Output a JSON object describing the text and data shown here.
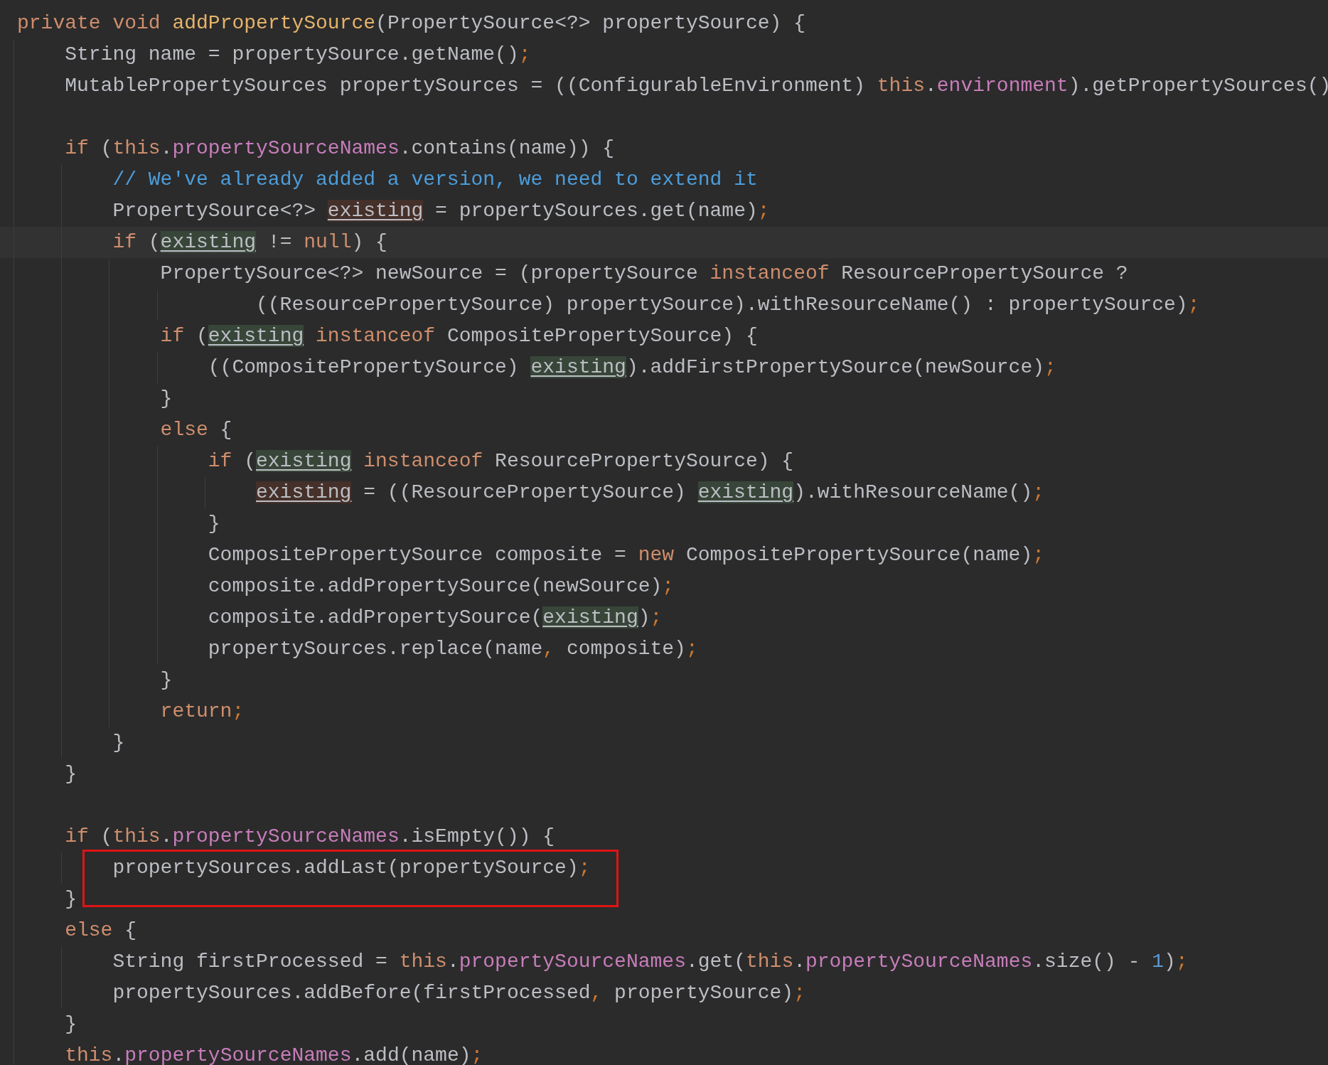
{
  "editor": {
    "lines": [
      {
        "tokens": [
          {
            "kind": "keyword",
            "text": "private void "
          },
          {
            "kind": "method",
            "text": "addPropertySource"
          },
          {
            "kind": "plain",
            "text": "(PropertySource<?> propertySource) {"
          }
        ],
        "children": [
          {
            "tokens": [
              {
                "kind": "plain",
                "text": "String name = propertySource.getName()"
              },
              {
                "kind": "punct",
                "text": ";"
              }
            ]
          },
          {
            "tokens": [
              {
                "kind": "plain",
                "text": "MutablePropertySources propertySources = ((ConfigurableEnvironment) "
              },
              {
                "kind": "keyword",
                "text": "this"
              },
              {
                "kind": "plain",
                "text": "."
              },
              {
                "kind": "field",
                "text": "environment"
              },
              {
                "kind": "plain",
                "text": ").getPropertySources()"
              }
            ]
          },
          {
            "space_before": true,
            "tokens": [
              {
                "kind": "keyword",
                "text": "if"
              },
              {
                "kind": "plain",
                "text": " ("
              },
              {
                "kind": "keyword",
                "text": "this"
              },
              {
                "kind": "plain",
                "text": "."
              },
              {
                "kind": "field",
                "text": "propertySourceNames"
              },
              {
                "kind": "plain",
                "text": ".contains(name)) {"
              }
            ],
            "children": [
              {
                "tokens": [
                  {
                    "kind": "comment",
                    "text": "// We've already added a version, we need to extend it"
                  }
                ]
              },
              {
                "tokens": [
                  {
                    "kind": "plain",
                    "text": "PropertySource<?> "
                  },
                  {
                    "kind": "write",
                    "text": "existing"
                  },
                  {
                    "kind": "plain",
                    "text": " = propertySources.get(name)"
                  },
                  {
                    "kind": "punct",
                    "text": ";"
                  }
                ]
              },
              {
                "current": true,
                "tokens": [
                  {
                    "kind": "keyword",
                    "text": "if"
                  },
                  {
                    "kind": "plain",
                    "text": " ("
                  },
                  {
                    "kind": "read",
                    "text": "existing"
                  },
                  {
                    "kind": "plain",
                    "text": " != "
                  },
                  {
                    "kind": "keyword",
                    "text": "null"
                  },
                  {
                    "kind": "plain",
                    "text": ") {"
                  }
                ],
                "children": [
                  {
                    "tokens": [
                      {
                        "kind": "plain",
                        "text": "PropertySource<?> newSource = (propertySource "
                      },
                      {
                        "kind": "keyword",
                        "text": "instanceof"
                      },
                      {
                        "kind": "plain",
                        "text": " ResourcePropertySource ?"
                      }
                    ],
                    "children": [
                      {
                        "wrapped": true,
                        "tokens": [
                          {
                            "kind": "plain",
                            "text": "((ResourcePropertySource) propertySource).withResourceName() : propertySource)"
                          },
                          {
                            "kind": "punct",
                            "text": ";"
                          }
                        ]
                      }
                    ]
                  },
                  {
                    "tokens": [
                      {
                        "kind": "keyword",
                        "text": "if"
                      },
                      {
                        "kind": "plain",
                        "text": " ("
                      },
                      {
                        "kind": "read",
                        "text": "existing"
                      },
                      {
                        "kind": "keyword",
                        "text": " instanceof"
                      },
                      {
                        "kind": "plain",
                        "text": " CompositePropertySource) {"
                      }
                    ],
                    "children": [
                      {
                        "tokens": [
                          {
                            "kind": "plain",
                            "text": "((CompositePropertySource) "
                          },
                          {
                            "kind": "read",
                            "text": "existing"
                          },
                          {
                            "kind": "plain",
                            "text": ").addFirstPropertySource(newSource)"
                          },
                          {
                            "kind": "punct",
                            "text": ";"
                          }
                        ]
                      }
                    ]
                  },
                  {
                    "tokens": [
                      {
                        "kind": "plain",
                        "text": "}"
                      }
                    ]
                  },
                  {
                    "tokens": [
                      {
                        "kind": "keyword",
                        "text": "else"
                      },
                      {
                        "kind": "plain",
                        "text": " {"
                      }
                    ],
                    "children": [
                      {
                        "tokens": [
                          {
                            "kind": "keyword",
                            "text": "if"
                          },
                          {
                            "kind": "plain",
                            "text": " ("
                          },
                          {
                            "kind": "read",
                            "text": "existing"
                          },
                          {
                            "kind": "keyword",
                            "text": " instanceof"
                          },
                          {
                            "kind": "plain",
                            "text": " ResourcePropertySource) {"
                          }
                        ],
                        "children": [
                          {
                            "tokens": [
                              {
                                "kind": "write",
                                "text": "existing"
                              },
                              {
                                "kind": "plain",
                                "text": " = ((ResourcePropertySource) "
                              },
                              {
                                "kind": "read",
                                "text": "existing"
                              },
                              {
                                "kind": "plain",
                                "text": ").withResourceName()"
                              },
                              {
                                "kind": "punct",
                                "text": ";"
                              }
                            ]
                          }
                        ]
                      },
                      {
                        "tokens": [
                          {
                            "kind": "plain",
                            "text": "}"
                          }
                        ]
                      },
                      {
                        "tokens": [
                          {
                            "kind": "plain",
                            "text": "CompositePropertySource composite = "
                          },
                          {
                            "kind": "keyword",
                            "text": "new"
                          },
                          {
                            "kind": "plain",
                            "text": " CompositePropertySource(name)"
                          },
                          {
                            "kind": "punct",
                            "text": ";"
                          }
                        ]
                      },
                      {
                        "tokens": [
                          {
                            "kind": "plain",
                            "text": "composite.addPropertySource(newSource)"
                          },
                          {
                            "kind": "punct",
                            "text": ";"
                          }
                        ]
                      },
                      {
                        "tokens": [
                          {
                            "kind": "plain",
                            "text": "composite.addPropertySource("
                          },
                          {
                            "kind": "read",
                            "text": "existing"
                          },
                          {
                            "kind": "plain",
                            "text": ")"
                          },
                          {
                            "kind": "punct",
                            "text": ";"
                          }
                        ]
                      },
                      {
                        "tokens": [
                          {
                            "kind": "plain",
                            "text": "propertySources.replace(name"
                          },
                          {
                            "kind": "punct",
                            "text": ","
                          },
                          {
                            "kind": "plain",
                            "text": " composite)"
                          },
                          {
                            "kind": "punct",
                            "text": ";"
                          }
                        ]
                      }
                    ]
                  },
                  {
                    "tokens": [
                      {
                        "kind": "plain",
                        "text": "}"
                      }
                    ]
                  },
                  {
                    "tokens": [
                      {
                        "kind": "keyword",
                        "text": "return"
                      },
                      {
                        "kind": "punct",
                        "text": ";"
                      }
                    ]
                  }
                ]
              },
              {
                "tokens": [
                  {
                    "kind": "plain",
                    "text": "}"
                  }
                ]
              }
            ]
          },
          {
            "tokens": [
              {
                "kind": "plain",
                "text": "}"
              }
            ]
          },
          {
            "space_before": true,
            "tokens": [
              {
                "kind": "keyword",
                "text": "if"
              },
              {
                "kind": "plain",
                "text": " ("
              },
              {
                "kind": "keyword",
                "text": "this"
              },
              {
                "kind": "plain",
                "text": "."
              },
              {
                "kind": "field",
                "text": "propertySourceNames"
              },
              {
                "kind": "plain",
                "text": ".isEmpty()) {"
              }
            ],
            "children": [
              {
                "boxed": true,
                "tokens": [
                  {
                    "kind": "plain",
                    "text": "propertySources.addLast(propertySource)"
                  },
                  {
                    "kind": "punct",
                    "text": ";"
                  }
                ]
              }
            ]
          },
          {
            "tokens": [
              {
                "kind": "plain",
                "text": "}"
              }
            ]
          },
          {
            "tokens": [
              {
                "kind": "keyword",
                "text": "else"
              },
              {
                "kind": "plain",
                "text": " {"
              }
            ],
            "children": [
              {
                "tokens": [
                  {
                    "kind": "plain",
                    "text": "String firstProcessed = "
                  },
                  {
                    "kind": "keyword",
                    "text": "this"
                  },
                  {
                    "kind": "plain",
                    "text": "."
                  },
                  {
                    "kind": "field",
                    "text": "propertySourceNames"
                  },
                  {
                    "kind": "plain",
                    "text": ".get("
                  },
                  {
                    "kind": "keyword",
                    "text": "this"
                  },
                  {
                    "kind": "plain",
                    "text": "."
                  },
                  {
                    "kind": "field",
                    "text": "propertySourceNames"
                  },
                  {
                    "kind": "plain",
                    "text": ".size() - "
                  },
                  {
                    "kind": "number",
                    "text": "1"
                  },
                  {
                    "kind": "plain",
                    "text": ")"
                  },
                  {
                    "kind": "punct",
                    "text": ";"
                  }
                ]
              },
              {
                "tokens": [
                  {
                    "kind": "plain",
                    "text": "propertySources.addBefore(firstProcessed"
                  },
                  {
                    "kind": "punct",
                    "text": ","
                  },
                  {
                    "kind": "plain",
                    "text": " propertySource)"
                  },
                  {
                    "kind": "punct",
                    "text": ";"
                  }
                ]
              }
            ]
          },
          {
            "tokens": [
              {
                "kind": "plain",
                "text": "}"
              }
            ]
          },
          {
            "tokens": [
              {
                "kind": "keyword",
                "text": "this"
              },
              {
                "kind": "plain",
                "text": "."
              },
              {
                "kind": "field",
                "text": "propertySourceNames"
              },
              {
                "kind": "plain",
                "text": ".add(name)"
              },
              {
                "kind": "punct",
                "text": ";"
              }
            ]
          }
        ]
      }
    ]
  }
}
